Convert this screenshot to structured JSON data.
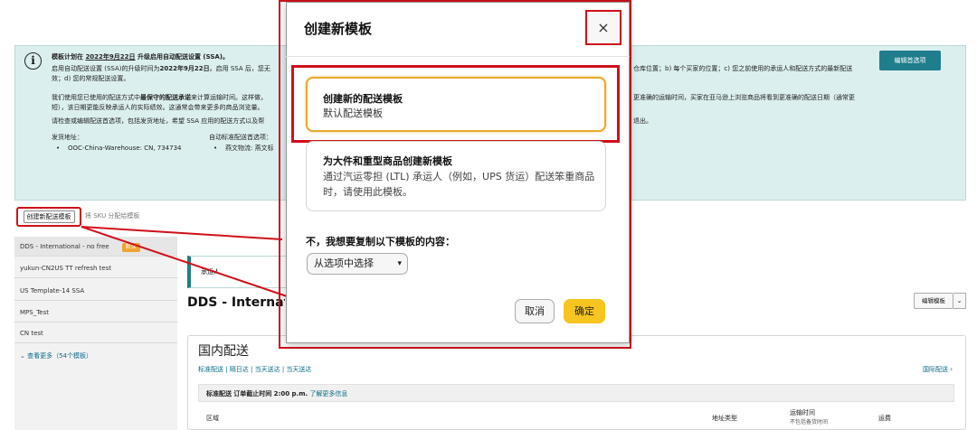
{
  "banner": {
    "heading_prefix": "模板计划在 ",
    "heading_date": "2022年9月22日",
    "heading_suffix": " 升级启用自动配送设置 (SSA)。",
    "line2_a": "启用自动配送设置 (SSA)的升级时间为",
    "line2_b": "2022年9月22日",
    "line2_c": "。启用 SSA 后，您无",
    "line2_right": "仓库位置；b) 每个买家的位置；c) 您之前使用的承运人和配送方式的最新配送",
    "line3": "效；d) 您的常规配送设置。",
    "line4_a": "我们使用您已使用的配送方式中",
    "line4_b": "最保守的配送承诺",
    "line4_c": "来计算运输时间。这样做，",
    "line4_right": "更准确的运输时间，买家在亚马逊上浏览商品将看到更准确的配送日期（通常更",
    "line5": "短），该日期更能反映承运人的实际绩效。这通常会带来更多的商品浏览量。",
    "line6": "请检查或编辑配送首选项，包括发货地址，希望 SSA 应用的配送方式以及帮",
    "line6_right": "退出。",
    "ship_from_label": "发货地址：",
    "ship_from_value": "OOC-China-Warehouse: CN, 734734",
    "auto_pref_label": "自动标准配送首选项：",
    "auto_pref_value": "燕文物流: 燕文标",
    "edit_pref_button": "编辑首选项"
  },
  "controls": {
    "create_template_button": "创建新配送模板",
    "map_sku_link": "将 SKU 分配给模板"
  },
  "sidebar": {
    "items": [
      {
        "label": "DDS - International - no free",
        "badge": "默认"
      },
      {
        "label": "yukun-CN2US TT refresh test"
      },
      {
        "label": "US Template-14 SSA"
      },
      {
        "label": "MPS_Test"
      },
      {
        "label": "CN test"
      }
    ],
    "see_more": "⌄ 查看更多（54个模板）"
  },
  "main": {
    "notice_text": "承运人",
    "title": "DDS - International - no free",
    "edit_template_button": "编辑模板",
    "domestic_title": "国内配送",
    "ship_speeds": "标准配送 | 隔日达 | 当天送达 | 当天送达",
    "intl_link": "国际配送 ›",
    "std_label": "标准配送",
    "std_cutoff": "订单截止时间 2:00 p.m.",
    "std_learn_more": "了解更多信息",
    "col_region": "区域",
    "col_address_type": "地址类型",
    "col_transit": "运输时间",
    "col_transit_sub": "不包括备货时间",
    "col_fee": "运费"
  },
  "modal": {
    "title": "创建新模板",
    "close": "×",
    "option1_title": "创建新的配送模板",
    "option1_desc": "默认配送模板",
    "option2_title": "为大件和重型商品创建新模板",
    "option2_desc": "通过汽运零担 (LTL) 承运人（例如，UPS 货运）配送笨重商品时，请使用此模板。",
    "copy_label": "不，我想要复制以下模板的内容：",
    "copy_select": "从选项中选择",
    "cancel": "取消",
    "ok": "确定"
  },
  "colors": {
    "annotation_red": "#d0101a",
    "teal_button": "#1f7d8c",
    "banner_bg": "#dcefef",
    "ok_yellow": "#f7c51f",
    "selected_border": "#e9a92c"
  }
}
